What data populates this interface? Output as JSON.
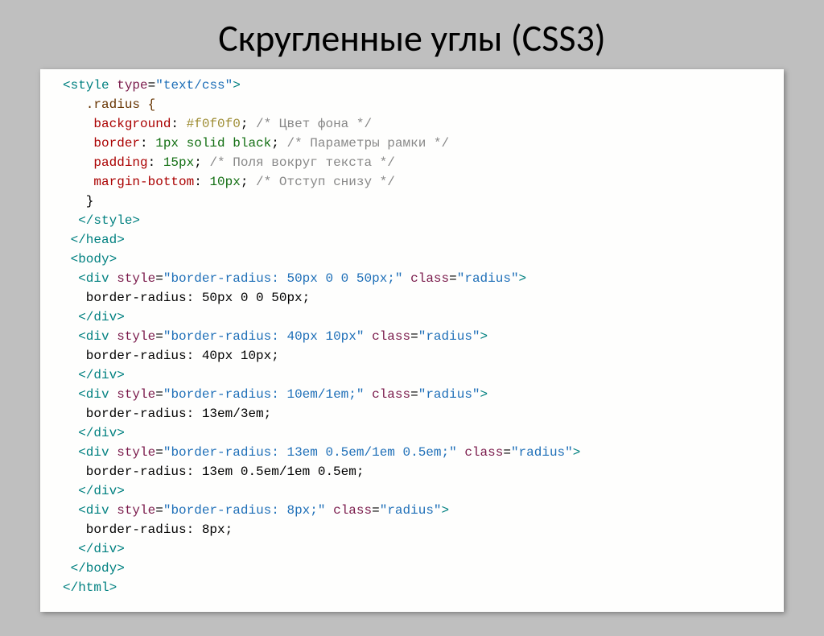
{
  "title": "Скругленные углы (CSS3)",
  "code": {
    "l1": {
      "tag_open": "<style",
      "attr_name": " type",
      "eq": "=",
      "val": "\"text/css\"",
      "tag_close": ">"
    },
    "l2": {
      "sel": "   .radius {"
    },
    "l3": {
      "indent": "    ",
      "prop": "background",
      "colon": ": ",
      "value": "#f0f0f0",
      "semi": ";",
      "comm": " /* Цвет фона */"
    },
    "l4": {
      "indent": "    ",
      "prop": "border",
      "colon": ": ",
      "value": "1px solid black",
      "semi": ";",
      "comm": " /* Параметры рамки */"
    },
    "l5": {
      "indent": "    ",
      "prop": "padding",
      "colon": ": ",
      "value": "15px",
      "semi": ";",
      "comm": " /* Поля вокруг текста */"
    },
    "l6": {
      "indent": "    ",
      "prop": "margin-bottom",
      "colon": ": ",
      "value": "10px",
      "semi": ";",
      "comm": " /* Отступ снизу */"
    },
    "l7": {
      "text": "   }"
    },
    "l8": {
      "tag": "  </style>"
    },
    "l9": {
      "tag": " </head>"
    },
    "l10": {
      "tag": " <body>"
    },
    "l11": {
      "open": "  <div ",
      "attr1": "style",
      "eq": "=",
      "val1": "\"border-radius: 50px 0 0 50px;\"",
      "sp": " ",
      "attr2": "class",
      "val2": "\"radius\"",
      "close": ">"
    },
    "l12": {
      "text": "   border-radius: 50px 0 0 50px;"
    },
    "l13": {
      "tag": "  </div>"
    },
    "l14": {
      "open": "  <div ",
      "attr1": "style",
      "eq": "=",
      "val1": "\"border-radius: 40px 10px\"",
      "sp": " ",
      "attr2": "class",
      "val2": "\"radius\"",
      "close": ">"
    },
    "l15": {
      "text": "   border-radius: 40px 10px;"
    },
    "l16": {
      "tag": "  </div>"
    },
    "l17": {
      "open": "  <div ",
      "attr1": "style",
      "eq": "=",
      "val1": "\"border-radius: 10em/1em;\"",
      "sp": " ",
      "attr2": "class",
      "val2": "\"radius\"",
      "close": ">"
    },
    "l18": {
      "text": "   border-radius: 13em/3em;"
    },
    "l19": {
      "tag": "  </div>"
    },
    "l20": {
      "open": "  <div ",
      "attr1": "style",
      "eq": "=",
      "val1": "\"border-radius: 13em 0.5em/1em 0.5em;\"",
      "sp": " ",
      "attr2": "class",
      "val2": "\"radius\"",
      "close": ">"
    },
    "l21": {
      "text": "   border-radius: 13em 0.5em/1em 0.5em;"
    },
    "l22": {
      "tag": "  </div>"
    },
    "l23": {
      "open": "  <div ",
      "attr1": "style",
      "eq": "=",
      "val1": "\"border-radius: 8px;\"",
      "sp": " ",
      "attr2": "class",
      "val2": "\"radius\"",
      "close": ">"
    },
    "l24": {
      "text": "   border-radius: 8px;"
    },
    "l25": {
      "tag": "  </div>"
    },
    "l26": {
      "tag": " </body>"
    },
    "l27": {
      "tag": "</html>"
    }
  }
}
